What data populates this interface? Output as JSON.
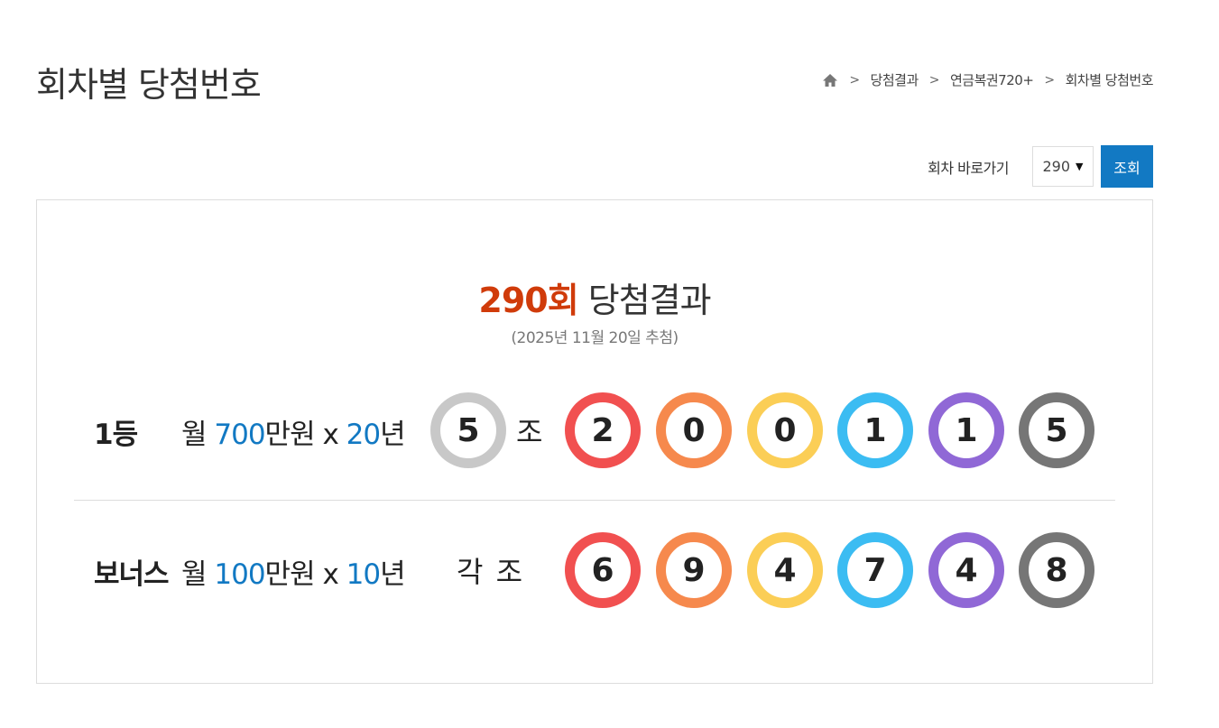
{
  "page": {
    "title": "회차별 당첨번호"
  },
  "breadcrumb": {
    "home_icon": "home-icon",
    "items": [
      "당첨결과",
      "연금복권720+",
      "회차별 당첨번호"
    ]
  },
  "jump": {
    "label": "회차 바로가기",
    "selected": "290",
    "button": "조회"
  },
  "result": {
    "round_text": "290회",
    "title_suffix": "당첨결과",
    "date": "(2025년 11월 20일 추첨)"
  },
  "first": {
    "rank": "1등",
    "prize_prefix": "월 ",
    "amount": "700",
    "prize_mid": "만원 x ",
    "years": "20",
    "prize_suffix": "년",
    "group": "5",
    "group_label": "조",
    "digits": [
      "2",
      "0",
      "0",
      "1",
      "1",
      "5"
    ]
  },
  "bonus": {
    "rank": "보너스",
    "prize_prefix": "월 ",
    "amount": "100",
    "prize_mid": "만원 x ",
    "years": "10",
    "prize_suffix": "년",
    "each_label": "각 조",
    "digits": [
      "6",
      "9",
      "4",
      "7",
      "4",
      "8"
    ]
  },
  "colors": {
    "accent_blue": "#1279c3",
    "round_red": "#d03b0a",
    "group_ball": "#c8c8c8",
    "balls": [
      "#f15050",
      "#f6894d",
      "#fbce56",
      "#3bbcf2",
      "#9068d6",
      "#767676"
    ]
  }
}
